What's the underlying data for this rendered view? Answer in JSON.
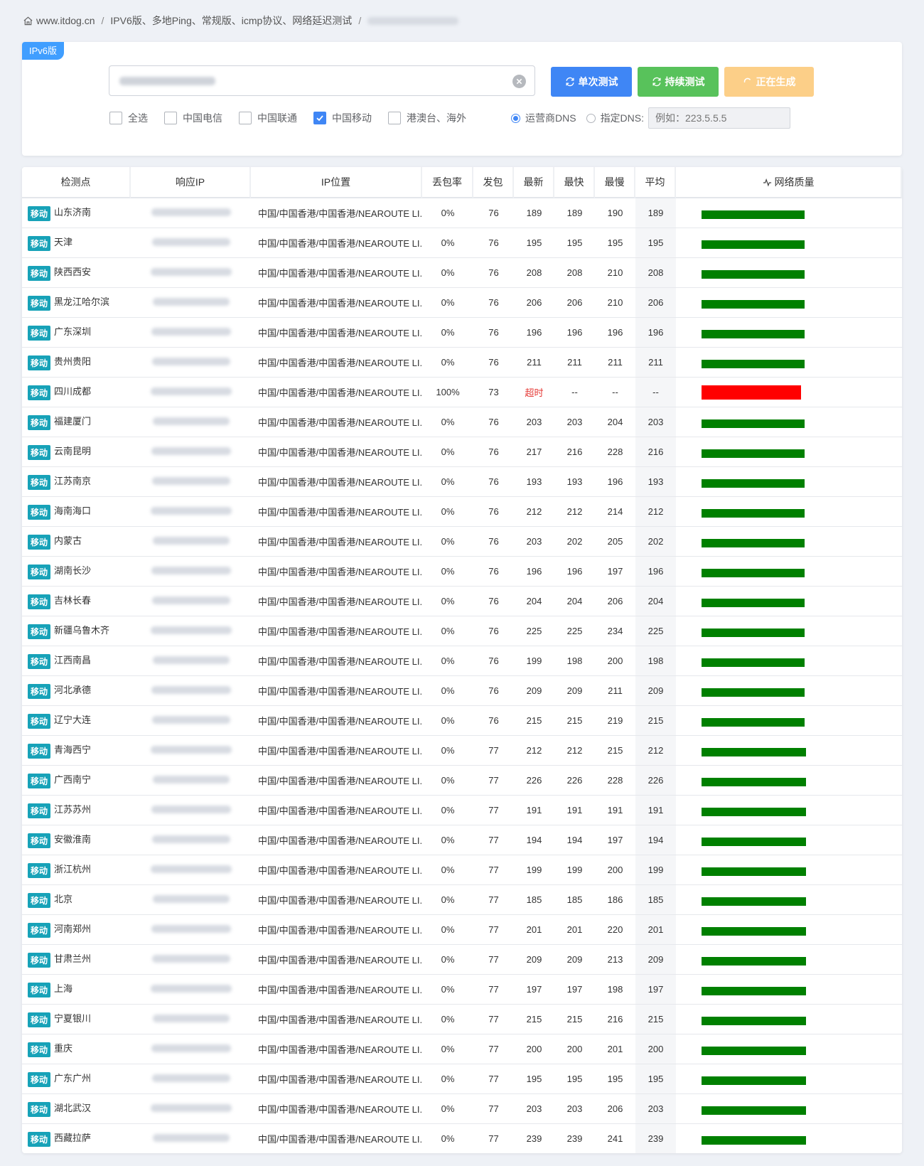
{
  "breadcrumb": {
    "site": "www.itdog.cn",
    "page": "IPV6版、多地Ping、常规版、icmp协议、网络延迟测试"
  },
  "panel": {
    "version_badge": "IPv6版",
    "single_test": "单次测试",
    "continuous_test": "持续测试",
    "generating": "正在生成",
    "checkboxes": [
      {
        "label": "全选",
        "checked": false
      },
      {
        "label": "中国电信",
        "checked": false
      },
      {
        "label": "中国联通",
        "checked": false
      },
      {
        "label": "中国移动",
        "checked": true
      },
      {
        "label": "港澳台、海外",
        "checked": false
      }
    ],
    "dns_operator": "运营商DNS",
    "dns_custom": "指定DNS:",
    "dns_placeholder": "例如：223.5.5.5"
  },
  "table": {
    "headers": {
      "node": "检测点",
      "ip": "响应IP",
      "location": "IP位置",
      "loss": "丢包率",
      "sent": "发包",
      "latest": "最新",
      "fastest": "最快",
      "slowest": "最慢",
      "avg": "平均",
      "quality": "网络质量"
    },
    "isp_tag": "移动",
    "location_text": "中国/中国香港/中国香港/NEAROUTE LI...",
    "colors": {
      "good": "#008000",
      "bad": "#ff0000",
      "tag": "#17a2b8"
    },
    "rows": [
      {
        "node": "山东济南",
        "loss": "0%",
        "sent": "76",
        "latest": "189",
        "fastest": "189",
        "slowest": "190",
        "avg": "189",
        "status": "good"
      },
      {
        "node": "天津",
        "loss": "0%",
        "sent": "76",
        "latest": "195",
        "fastest": "195",
        "slowest": "195",
        "avg": "195",
        "status": "good"
      },
      {
        "node": "陕西西安",
        "loss": "0%",
        "sent": "76",
        "latest": "208",
        "fastest": "208",
        "slowest": "210",
        "avg": "208",
        "status": "good"
      },
      {
        "node": "黑龙江哈尔滨",
        "loss": "0%",
        "sent": "76",
        "latest": "206",
        "fastest": "206",
        "slowest": "210",
        "avg": "206",
        "status": "good"
      },
      {
        "node": "广东深圳",
        "loss": "0%",
        "sent": "76",
        "latest": "196",
        "fastest": "196",
        "slowest": "196",
        "avg": "196",
        "status": "good"
      },
      {
        "node": "贵州贵阳",
        "loss": "0%",
        "sent": "76",
        "latest": "211",
        "fastest": "211",
        "slowest": "211",
        "avg": "211",
        "status": "good"
      },
      {
        "node": "四川成都",
        "loss": "100%",
        "sent": "73",
        "latest": "超时",
        "fastest": "--",
        "slowest": "--",
        "avg": "--",
        "status": "bad"
      },
      {
        "node": "福建厦门",
        "loss": "0%",
        "sent": "76",
        "latest": "203",
        "fastest": "203",
        "slowest": "204",
        "avg": "203",
        "status": "good"
      },
      {
        "node": "云南昆明",
        "loss": "0%",
        "sent": "76",
        "latest": "217",
        "fastest": "216",
        "slowest": "228",
        "avg": "216",
        "status": "good"
      },
      {
        "node": "江苏南京",
        "loss": "0%",
        "sent": "76",
        "latest": "193",
        "fastest": "193",
        "slowest": "196",
        "avg": "193",
        "status": "good"
      },
      {
        "node": "海南海口",
        "loss": "0%",
        "sent": "76",
        "latest": "212",
        "fastest": "212",
        "slowest": "214",
        "avg": "212",
        "status": "good"
      },
      {
        "node": "内蒙古",
        "loss": "0%",
        "sent": "76",
        "latest": "203",
        "fastest": "202",
        "slowest": "205",
        "avg": "202",
        "status": "good"
      },
      {
        "node": "湖南长沙",
        "loss": "0%",
        "sent": "76",
        "latest": "196",
        "fastest": "196",
        "slowest": "197",
        "avg": "196",
        "status": "good"
      },
      {
        "node": "吉林长春",
        "loss": "0%",
        "sent": "76",
        "latest": "204",
        "fastest": "204",
        "slowest": "206",
        "avg": "204",
        "status": "good"
      },
      {
        "node": "新疆乌鲁木齐",
        "loss": "0%",
        "sent": "76",
        "latest": "225",
        "fastest": "225",
        "slowest": "234",
        "avg": "225",
        "status": "good"
      },
      {
        "node": "江西南昌",
        "loss": "0%",
        "sent": "76",
        "latest": "199",
        "fastest": "198",
        "slowest": "200",
        "avg": "198",
        "status": "good"
      },
      {
        "node": "河北承德",
        "loss": "0%",
        "sent": "76",
        "latest": "209",
        "fastest": "209",
        "slowest": "211",
        "avg": "209",
        "status": "good"
      },
      {
        "node": "辽宁大连",
        "loss": "0%",
        "sent": "76",
        "latest": "215",
        "fastest": "215",
        "slowest": "219",
        "avg": "215",
        "status": "good"
      },
      {
        "node": "青海西宁",
        "loss": "0%",
        "sent": "77",
        "latest": "212",
        "fastest": "212",
        "slowest": "215",
        "avg": "212",
        "status": "good"
      },
      {
        "node": "广西南宁",
        "loss": "0%",
        "sent": "77",
        "latest": "226",
        "fastest": "226",
        "slowest": "228",
        "avg": "226",
        "status": "good"
      },
      {
        "node": "江苏苏州",
        "loss": "0%",
        "sent": "77",
        "latest": "191",
        "fastest": "191",
        "slowest": "191",
        "avg": "191",
        "status": "good"
      },
      {
        "node": "安徽淮南",
        "loss": "0%",
        "sent": "77",
        "latest": "194",
        "fastest": "194",
        "slowest": "197",
        "avg": "194",
        "status": "good"
      },
      {
        "node": "浙江杭州",
        "loss": "0%",
        "sent": "77",
        "latest": "199",
        "fastest": "199",
        "slowest": "200",
        "avg": "199",
        "status": "good"
      },
      {
        "node": "北京",
        "loss": "0%",
        "sent": "77",
        "latest": "185",
        "fastest": "185",
        "slowest": "186",
        "avg": "185",
        "status": "good"
      },
      {
        "node": "河南郑州",
        "loss": "0%",
        "sent": "77",
        "latest": "201",
        "fastest": "201",
        "slowest": "220",
        "avg": "201",
        "status": "good"
      },
      {
        "node": "甘肃兰州",
        "loss": "0%",
        "sent": "77",
        "latest": "209",
        "fastest": "209",
        "slowest": "213",
        "avg": "209",
        "status": "good"
      },
      {
        "node": "上海",
        "loss": "0%",
        "sent": "77",
        "latest": "197",
        "fastest": "197",
        "slowest": "198",
        "avg": "197",
        "status": "good"
      },
      {
        "node": "宁夏银川",
        "loss": "0%",
        "sent": "77",
        "latest": "215",
        "fastest": "215",
        "slowest": "216",
        "avg": "215",
        "status": "good"
      },
      {
        "node": "重庆",
        "loss": "0%",
        "sent": "77",
        "latest": "200",
        "fastest": "200",
        "slowest": "201",
        "avg": "200",
        "status": "good"
      },
      {
        "node": "广东广州",
        "loss": "0%",
        "sent": "77",
        "latest": "195",
        "fastest": "195",
        "slowest": "195",
        "avg": "195",
        "status": "good"
      },
      {
        "node": "湖北武汉",
        "loss": "0%",
        "sent": "77",
        "latest": "203",
        "fastest": "203",
        "slowest": "206",
        "avg": "203",
        "status": "good"
      },
      {
        "node": "西藏拉萨",
        "loss": "0%",
        "sent": "77",
        "latest": "239",
        "fastest": "239",
        "slowest": "241",
        "avg": "239",
        "status": "good"
      }
    ]
  }
}
